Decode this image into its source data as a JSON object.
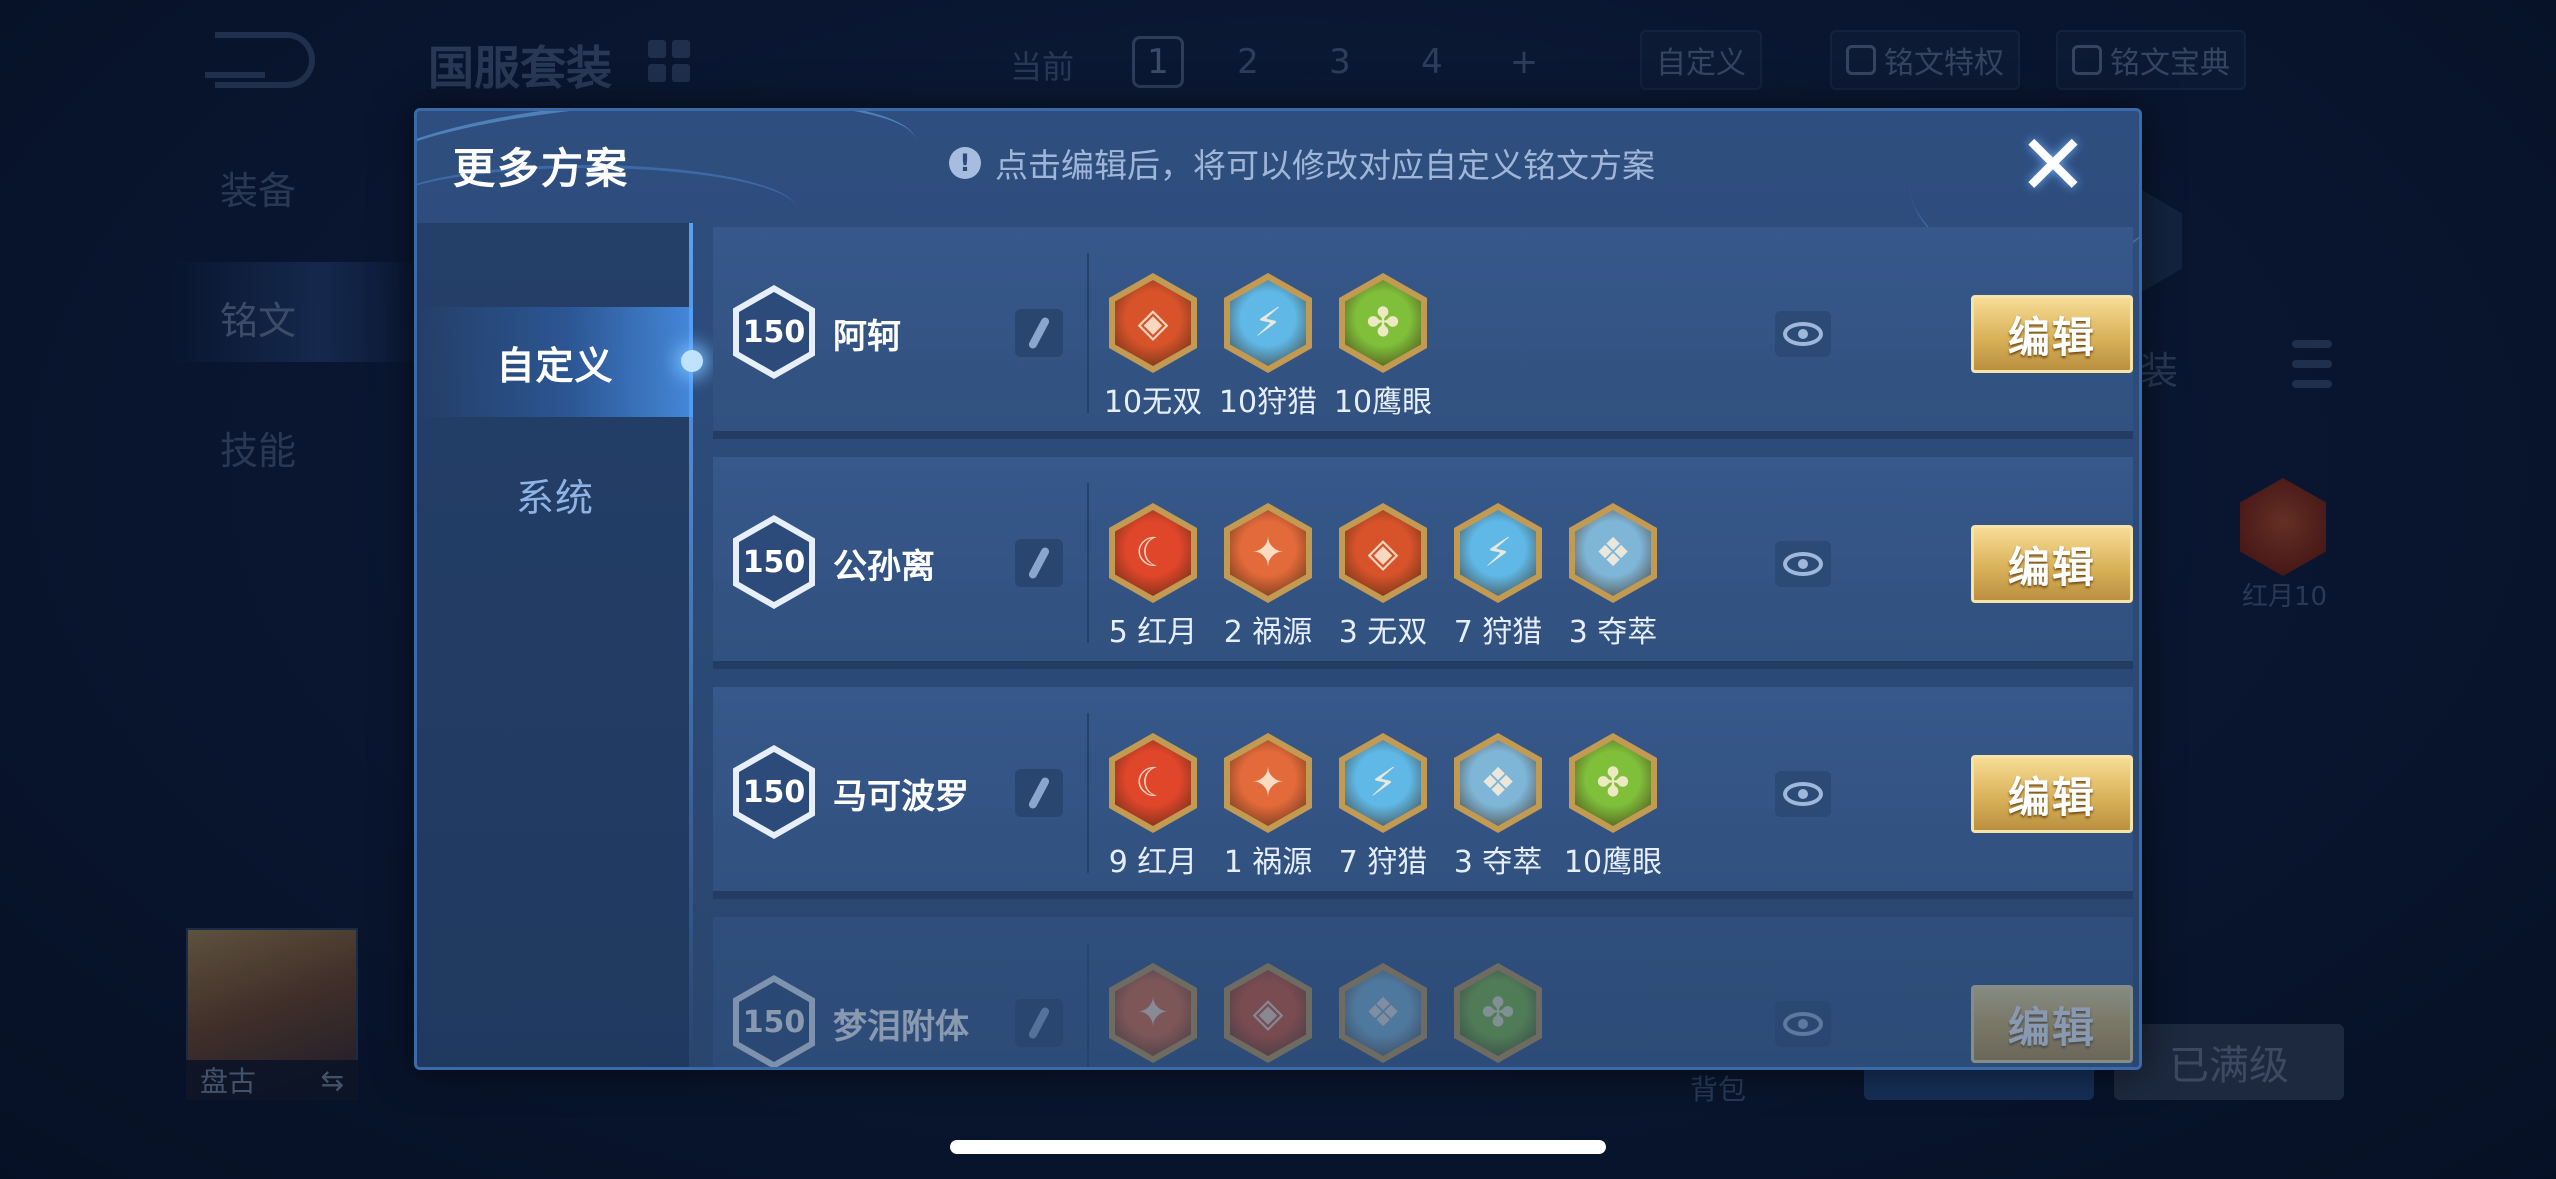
{
  "background": {
    "title": "国服套装",
    "current_label": "当前",
    "pages": [
      "1",
      "2",
      "3",
      "4",
      "+"
    ],
    "custom_label": "自定义",
    "privilege_label": "铭文特权",
    "guide_label": "铭文宝典",
    "left_menu": [
      "装备",
      "铭文",
      "技能"
    ],
    "hero_name": "盘古",
    "right_set_label": "装",
    "rune_label": "红月10",
    "bag_label": "背包",
    "max_level_label": "已满级"
  },
  "modal": {
    "title": "更多方案",
    "hint": "点击编辑后，将可以修改对应自定义铭文方案",
    "close_label": "✕",
    "tabs": [
      {
        "label": "自定义",
        "active": true
      },
      {
        "label": "系统",
        "active": false
      }
    ],
    "edit_label": "编辑",
    "rows": [
      {
        "level": "150",
        "name": "阿轲",
        "runes": [
          {
            "label": "10无双",
            "color": "#d8532a",
            "icon": "wushuang-icon"
          },
          {
            "label": "10狩猎",
            "color": "#5fb8e6",
            "icon": "shoulie-icon"
          },
          {
            "label": "10鹰眼",
            "color": "#7fbf3a",
            "icon": "yingyan-icon"
          }
        ]
      },
      {
        "level": "150",
        "name": "公孙离",
        "runes": [
          {
            "label": "5 红月",
            "color": "#e0462a",
            "icon": "hongyue-icon"
          },
          {
            "label": "2 祸源",
            "color": "#e36a3a",
            "icon": "huoyuan-icon"
          },
          {
            "label": "3 无双",
            "color": "#d8532a",
            "icon": "wushuang-icon"
          },
          {
            "label": "7 狩猎",
            "color": "#5fb8e6",
            "icon": "shoulie-icon"
          },
          {
            "label": "3 夺萃",
            "color": "#7fb6d8",
            "icon": "duocui-icon"
          }
        ]
      },
      {
        "level": "150",
        "name": "马可波罗",
        "runes": [
          {
            "label": "9 红月",
            "color": "#e0462a",
            "icon": "hongyue-icon"
          },
          {
            "label": "1 祸源",
            "color": "#e36a3a",
            "icon": "huoyuan-icon"
          },
          {
            "label": "7 狩猎",
            "color": "#5fb8e6",
            "icon": "shoulie-icon"
          },
          {
            "label": "3 夺萃",
            "color": "#7fb6d8",
            "icon": "duocui-icon"
          },
          {
            "label": "10鹰眼",
            "color": "#7fbf3a",
            "icon": "yingyan-icon"
          }
        ]
      },
      {
        "level": "150",
        "name": "梦泪附体",
        "runes": [
          {
            "label": "",
            "color": "#e36a3a",
            "icon": "huoyuan-icon"
          },
          {
            "label": "",
            "color": "#d8532a",
            "icon": "wushuang-icon"
          },
          {
            "label": "",
            "color": "#7fb6d8",
            "icon": "duocui-icon"
          },
          {
            "label": "",
            "color": "#7fbf3a",
            "icon": "yingyan-icon"
          }
        ]
      }
    ]
  }
}
